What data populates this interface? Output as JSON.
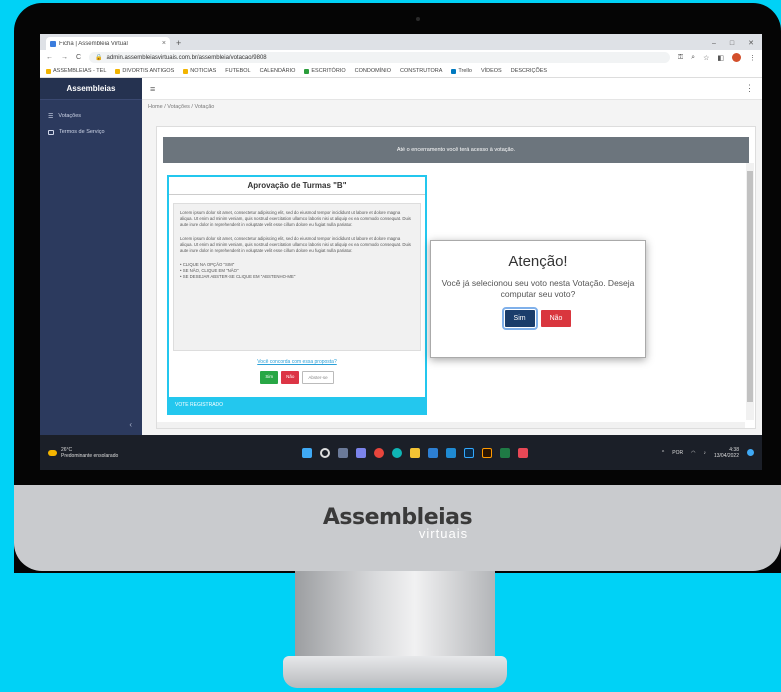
{
  "browser": {
    "tab_title": "Ficha | Assembleia Virtual",
    "tab_close": "×",
    "new_tab": "+",
    "window_controls": [
      "–",
      "□",
      "✕"
    ],
    "address": "admin.assembleiasvirtuais.com.br/assembleia/votacao/9808",
    "nav": {
      "back": "←",
      "forward": "→",
      "reload": "C"
    },
    "bookmarks": [
      "ASSEMBLEIAS - TEL",
      "DIVORTIS ANTIGOS",
      "NOTICIAS",
      "FUTEBOL",
      "CALENDÁRIO",
      "ESCRITÓRIO",
      "CONDOMÍNIO",
      "CONSTRUTORA",
      "Trello",
      "VÍDEOS",
      "DESCRIÇÕES"
    ]
  },
  "sidebar": {
    "brand": "Assembleias",
    "items": [
      {
        "label": "Votações"
      },
      {
        "label": "Termos de Serviço"
      }
    ],
    "collapse": "‹"
  },
  "header": {
    "menu": "≡",
    "right": "⋮"
  },
  "breadcrumb": "Home / Votações / Votação",
  "banner_text": "Até o encerramento você terá acesso à votação.",
  "card": {
    "title": "Aprovação de Turmas \"B\"",
    "paragraph1": "Lorem ipsum dolor sit amet, consectetur adipiscing elit, sed do eiusmod tempor incididunt ut labore et dolore magna aliqua. Ut enim ad minim veniam, quis nostrud exercitation ullamco laboris nisi ut aliquip ex ea commodo consequat. Duis aute irure dolor in reprehenderit in voluptate velit esse cillum dolore eu fugiat nulla pariatur.",
    "paragraph2": "Lorem ipsum dolor sit amet, consectetur adipiscing elit, sed do eiusmod tempor incididunt ut labore et dolore magna aliqua. Ut enim ad minim veniam, quis nostrud exercitation ullamco laboris nisi ut aliquip ex ea commodo consequat. Duis aute irure dolor in reprehenderit in voluptate velit esse cillum dolore eu fugiat nulla pariatur.",
    "bullets": [
      "• CLIQUE NA OPÇÃO \"SIM\"",
      "• SE NÃO, CLIQUE EM \"NÃO\"",
      "• SE DESEJAR ABSTER-SE CLIQUE EM \"ABSTENHO-ME\""
    ],
    "question": "Você concorda com essa proposta?",
    "buttons": {
      "sim": "Sim",
      "nao": "Não",
      "abster": "Abster-se"
    },
    "footer": "VOTE REGISTRADO"
  },
  "modal": {
    "title": "Atenção!",
    "text": "Você já selecionou seu voto nesta Votação. Deseja computar seu voto?",
    "sim": "Sim",
    "nao": "Não"
  },
  "taskbar": {
    "weather_temp": "26°C",
    "weather_desc": "Predominante ensolarado",
    "time": "4:38",
    "date": "13/04/2022",
    "lang": "POR"
  },
  "monitor": {
    "brand": "Assembleias",
    "brand_sub": "virtuais"
  },
  "colors": {
    "background": "#00d2f6",
    "sidebar": "#2c3a5e",
    "accent": "#23c7ee",
    "sim": "#28a745",
    "nao": "#dc3545",
    "modal_sim": "#1a3d6b",
    "modal_nao": "#d9363e"
  }
}
